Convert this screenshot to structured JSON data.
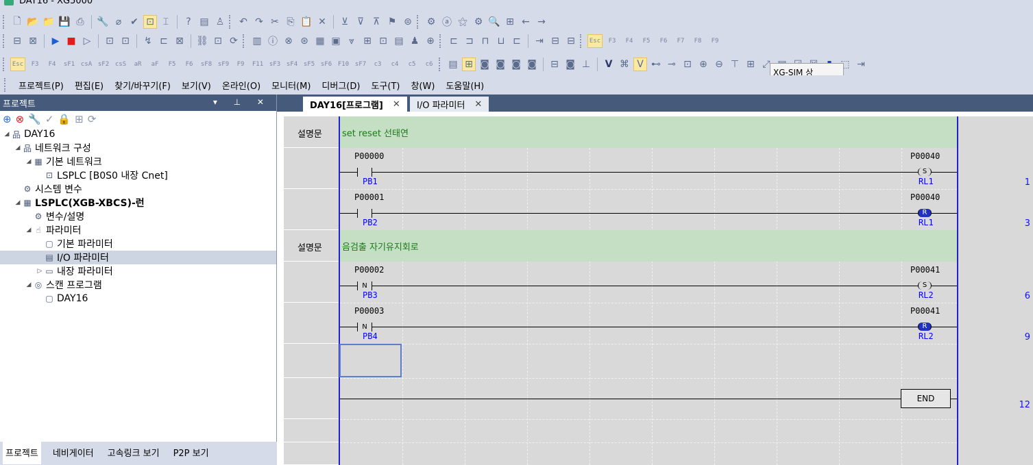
{
  "window": {
    "title": "DAY16 - XG5000"
  },
  "toolbar3_keys": [
    "Esc",
    "F3",
    "F4",
    "sF1",
    "csA",
    "sF2",
    "csS",
    "aR",
    "aF",
    "F5",
    "F6",
    "sF8",
    "sF9",
    "F9",
    "F11",
    "sF3",
    "sF4",
    "sF5",
    "sF6",
    "F10",
    "sF7",
    "c3",
    "c4",
    "c5",
    "c6"
  ],
  "toolbar2_keys": [
    "Esc",
    "F3",
    "F4",
    "F5",
    "F6",
    "F7",
    "F8",
    "F9"
  ],
  "menu": [
    "프로젝트(P)",
    "편집(E)",
    "찾기/바꾸기(F)",
    "보기(V)",
    "온라인(O)",
    "모니터(M)",
    "디버그(D)",
    "도구(T)",
    "창(W)",
    "도움말(H)"
  ],
  "xgsim": {
    "label": "XG-SIM 상",
    "leds": [
      "#ff0000",
      "#007000",
      "#6b6b00"
    ]
  },
  "project_panel": {
    "title": "프로젝트",
    "controls": "▾ ⊥ ✕",
    "tree": [
      {
        "label": "DAY16",
        "level": 0,
        "toggle": "◢",
        "icon": "network-icon",
        "bold": false
      },
      {
        "label": "네트워크 구성",
        "level": 1,
        "toggle": "◢",
        "icon": "network-icon",
        "bold": false
      },
      {
        "label": "기본 네트워크",
        "level": 2,
        "toggle": "◢",
        "icon": "grid-icon",
        "bold": false
      },
      {
        "label": "LSPLC [B0S0 내장 Cnet]",
        "level": 3,
        "toggle": "",
        "icon": "device-icon",
        "bold": false
      },
      {
        "label": "시스템 변수",
        "level": 1,
        "toggle": "",
        "icon": "variable-icon",
        "bold": false
      },
      {
        "label": "LSPLC(XGB-XBCS)-런",
        "level": 1,
        "toggle": "◢",
        "icon": "plc-icon",
        "bold": true
      },
      {
        "label": "변수/설명",
        "level": 2,
        "toggle": "",
        "icon": "variable-icon",
        "bold": false
      },
      {
        "label": "파라미터",
        "level": 2,
        "toggle": "◢",
        "icon": "parameter-icon",
        "bold": false
      },
      {
        "label": "기본 파라미터",
        "level": 3,
        "toggle": "",
        "icon": "document-icon",
        "bold": false
      },
      {
        "label": "I/O 파라미터",
        "level": 3,
        "toggle": "",
        "icon": "io-icon",
        "bold": false,
        "selected": true
      },
      {
        "label": "내장 파라미터",
        "level": 3,
        "toggle": "▷",
        "icon": "module-icon",
        "bold": false
      },
      {
        "label": "스캔 프로그램",
        "level": 2,
        "toggle": "◢",
        "icon": "scan-icon",
        "bold": false
      },
      {
        "label": "DAY16",
        "level": 3,
        "toggle": "",
        "icon": "ld-icon",
        "bold": false
      }
    ],
    "bottom_tabs": [
      "프로젝트",
      "네비게이터",
      "고속링크 보기",
      "P2P 보기"
    ]
  },
  "doc_tabs": [
    {
      "label": "DAY16[프로그램]",
      "active": true
    },
    {
      "label": "I/O 파라미터",
      "active": false
    }
  ],
  "ladder": {
    "comment_label": "설명문",
    "comments": [
      "set reset 선태연",
      "음검출 자기유지회로"
    ],
    "rungs": [
      {
        "row": "1",
        "contact_addr": "P00000",
        "contact_sym": "PB1",
        "contact_type": "",
        "coil_addr": "P00040",
        "coil_sym": "RL1",
        "coil_type": "S"
      },
      {
        "row": "3",
        "contact_addr": "P00001",
        "contact_sym": "PB2",
        "contact_type": "",
        "coil_addr": "P00040",
        "coil_sym": "RL1",
        "coil_type": "R"
      },
      {
        "row": "6",
        "contact_addr": "P00002",
        "contact_sym": "PB3",
        "contact_type": "N",
        "coil_addr": "P00041",
        "coil_sym": "RL2",
        "coil_type": "S"
      },
      {
        "row": "9",
        "contact_addr": "P00003",
        "contact_sym": "PB4",
        "contact_type": "N",
        "coil_addr": "P00041",
        "coil_sym": "RL2",
        "coil_type": "R"
      }
    ],
    "end_row": "12",
    "end_label": "END"
  }
}
